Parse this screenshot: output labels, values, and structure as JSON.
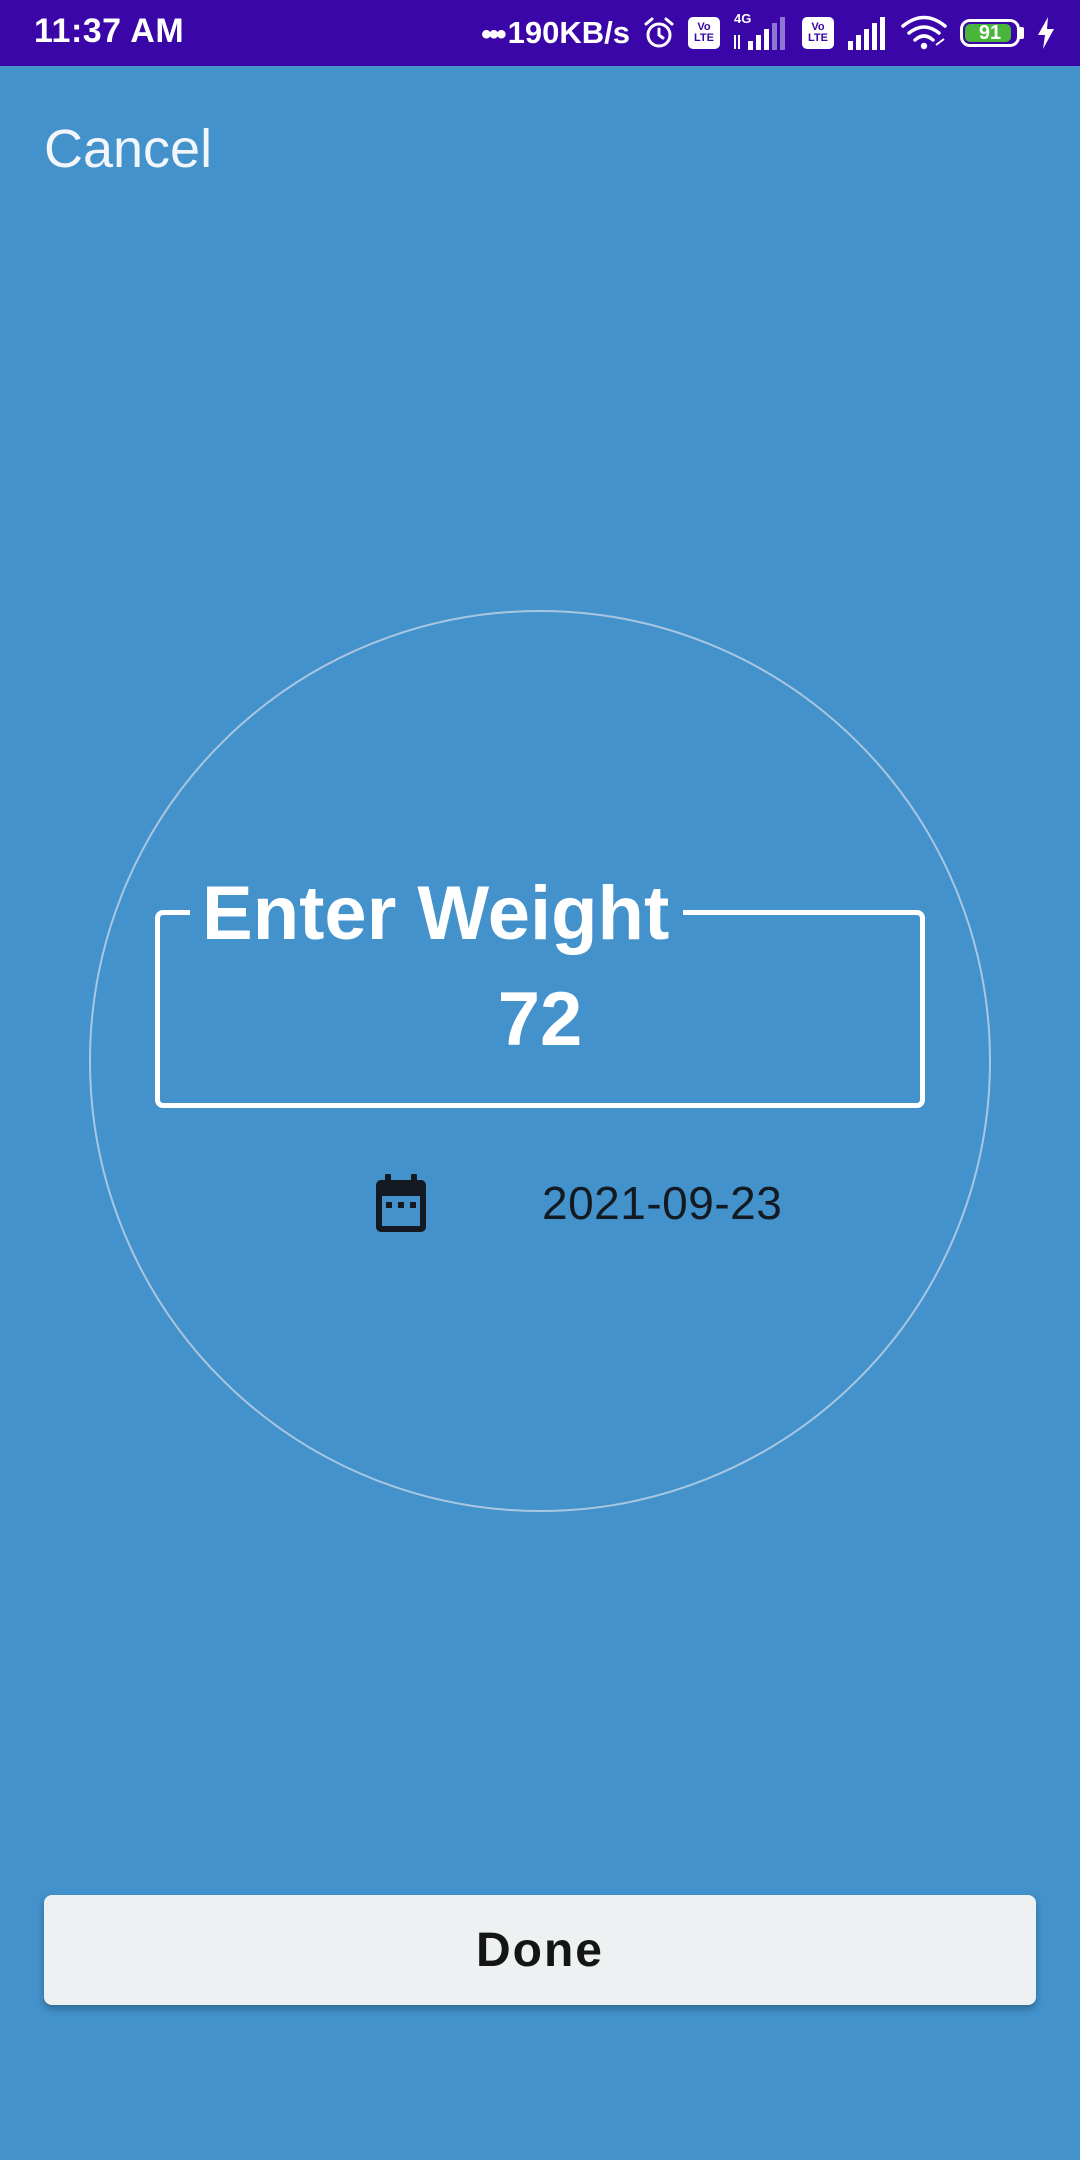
{
  "status_bar": {
    "time": "11:37 AM",
    "network_speed": "190KB/s",
    "volte_label_top": "Vo",
    "volte_label_bottom": "LTE",
    "network_type": "4G",
    "battery_level": "91",
    "icons": [
      "dots-icon",
      "alarm-icon",
      "volte-icon",
      "signal-icon",
      "wifi-icon",
      "battery-icon",
      "charging-icon"
    ]
  },
  "header": {
    "cancel_label": "Cancel"
  },
  "weight_entry": {
    "label": "Enter Weight",
    "value": "72"
  },
  "date_row": {
    "icon": "calendar-icon",
    "date": "2021-09-23"
  },
  "footer": {
    "done_label": "Done"
  },
  "colors": {
    "background": "#4392cc",
    "status_bar": "#3a06a8",
    "button_bg": "#edf1f1",
    "battery_fill": "#47b63a"
  }
}
